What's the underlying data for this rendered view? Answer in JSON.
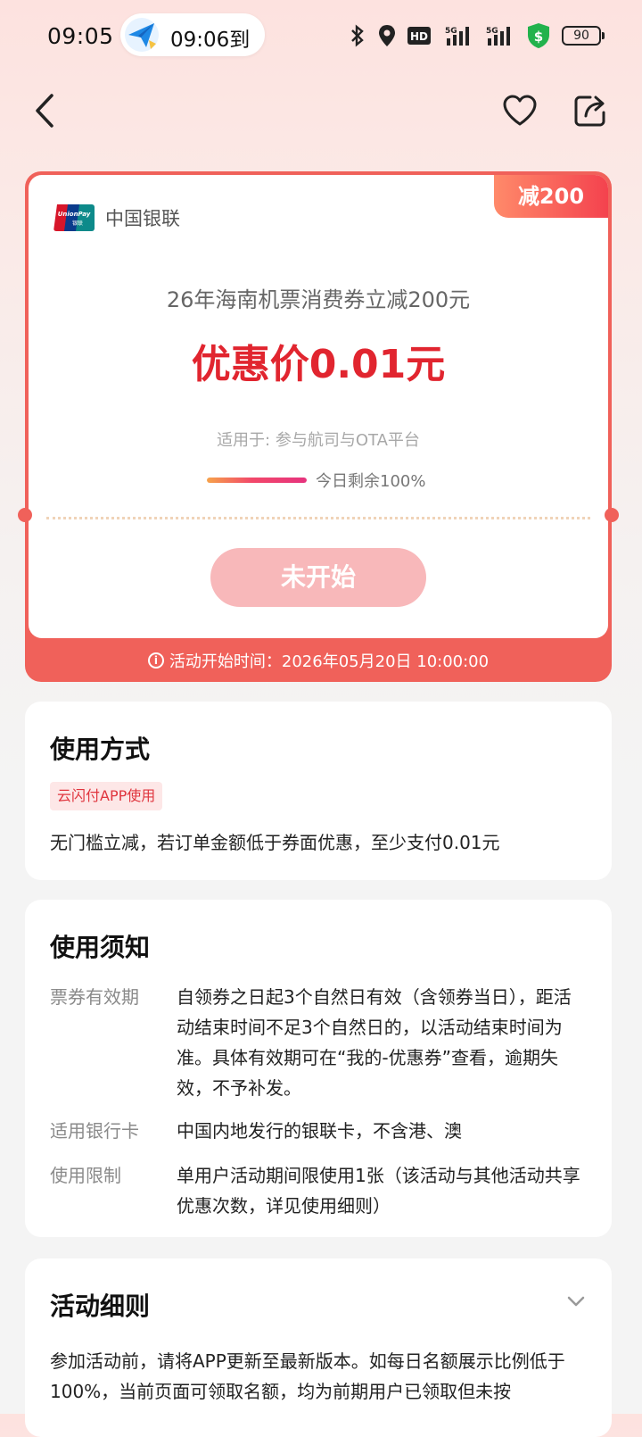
{
  "status_bar": {
    "time": "09:05",
    "notification": "09:06到",
    "hd": "HD",
    "sig1": "5G",
    "sig2": "5G",
    "battery": "90"
  },
  "coupon": {
    "badge": "减200",
    "brand": "中国银联",
    "title": "26年海南机票消费券立减200元",
    "price": "优惠价0.01元",
    "scope": "适用于: 参与航司与OTA平台",
    "remaining_label": "今日剩余100%",
    "remaining_percent": 100,
    "status_button": "未开始",
    "start_time": "活动开始时间：2026年05月20日 10:00:00"
  },
  "usage": {
    "title": "使用方式",
    "tag": "云闪付APP使用",
    "desc": "无门槛立减，若订单金额低于券面优惠，至少支付0.01元"
  },
  "notice": {
    "title": "使用须知",
    "rows": [
      {
        "label": "票券有效期",
        "text": "自领券之日起3个自然日有效（含领券当日），距活动结束时间不足3个自然日的，以活动结束时间为准。具体有效期可在“我的-优惠券”查看，逾期失效，不予补发。"
      },
      {
        "label": "适用银行卡",
        "text": "中国内地发行的银联卡，不含港、澳"
      },
      {
        "label": "使用限制",
        "text": "单用户活动期间限使用1张（该活动与其他活动共享优惠次数，详见使用细则）"
      }
    ]
  },
  "details": {
    "title": "活动细则",
    "text": "参加活动前，请将APP更新至最新版本。如每日名额展示比例低于100%，当前页面可领取名额，均为前期用户已领取但未按"
  },
  "colors": {
    "accent": "#e1252f",
    "card_border": "#f0615a",
    "button_disabled": "#f8b8ba"
  },
  "icons": {
    "back": "back-arrow-icon",
    "favorite": "heart-icon",
    "share": "share-icon",
    "expand": "chevron-down-icon",
    "info": "info-icon"
  }
}
